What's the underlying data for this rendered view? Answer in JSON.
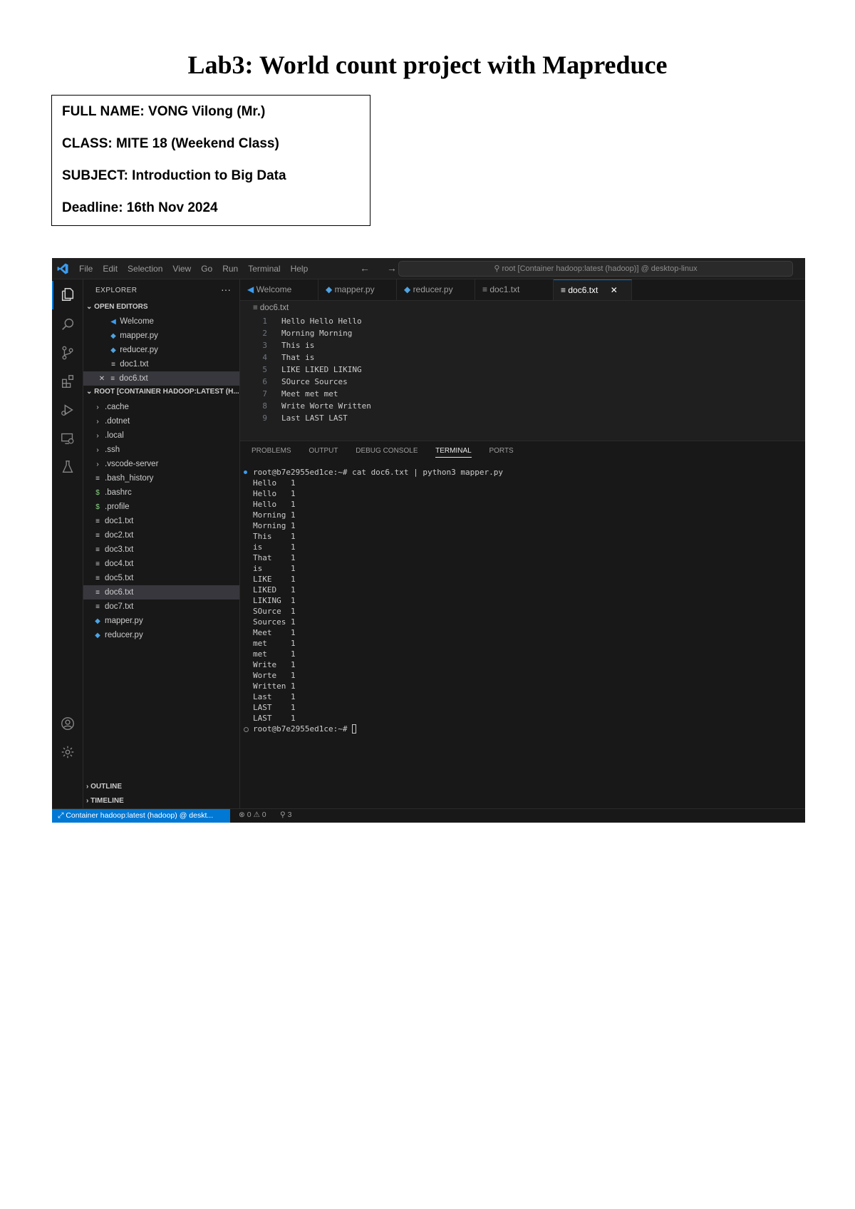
{
  "document": {
    "title": "Lab3: World count project with Mapreduce",
    "info": {
      "name": "FULL NAME: VONG Vilong (Mr.)",
      "class": "CLASS: MITE 18 (Weekend Class)",
      "subject": "SUBJECT: Introduction to Big Data",
      "deadline": "Deadline: 16th Nov 2024"
    }
  },
  "titlebar": {
    "menu": [
      "File",
      "Edit",
      "Selection",
      "View",
      "Go",
      "Run",
      "Terminal",
      "Help"
    ],
    "nav": "← →",
    "command_center": "root [Container hadoop:latest (hadoop)] @ desktop-linux"
  },
  "sidebar": {
    "header": "EXPLORER",
    "more": "···",
    "open_editors_label": "OPEN EDITORS",
    "open_editors": [
      {
        "name": "Welcome",
        "icon": "vscode-icon"
      },
      {
        "name": "mapper.py",
        "icon": "python-icon"
      },
      {
        "name": "reducer.py",
        "icon": "python-icon"
      },
      {
        "name": "doc1.txt",
        "icon": "text-file-icon"
      },
      {
        "name": "doc6.txt",
        "icon": "text-file-icon"
      }
    ],
    "root_label": "ROOT [CONTAINER HADOOP:LATEST (H...",
    "tree": [
      {
        "name": ".cache",
        "type": "folder"
      },
      {
        "name": ".dotnet",
        "type": "folder"
      },
      {
        "name": ".local",
        "type": "folder"
      },
      {
        "name": ".ssh",
        "type": "folder"
      },
      {
        "name": ".vscode-server",
        "type": "folder"
      },
      {
        "name": ".bash_history",
        "type": "txt"
      },
      {
        "name": ".bashrc",
        "type": "sh"
      },
      {
        "name": ".profile",
        "type": "sh"
      },
      {
        "name": "doc1.txt",
        "type": "txt"
      },
      {
        "name": "doc2.txt",
        "type": "txt"
      },
      {
        "name": "doc3.txt",
        "type": "txt"
      },
      {
        "name": "doc4.txt",
        "type": "txt"
      },
      {
        "name": "doc5.txt",
        "type": "txt"
      },
      {
        "name": "doc6.txt",
        "type": "txt"
      },
      {
        "name": "doc7.txt",
        "type": "txt"
      },
      {
        "name": "mapper.py",
        "type": "py"
      },
      {
        "name": "reducer.py",
        "type": "py"
      }
    ],
    "outline_label": "OUTLINE",
    "timeline_label": "TIMELINE"
  },
  "tabs": [
    {
      "label": "Welcome",
      "icon": "vscode-icon"
    },
    {
      "label": "mapper.py",
      "icon": "python-icon"
    },
    {
      "label": "reducer.py",
      "icon": "python-icon"
    },
    {
      "label": "doc1.txt",
      "icon": "text-file-icon"
    },
    {
      "label": "doc6.txt",
      "icon": "text-file-icon",
      "active": true
    }
  ],
  "editor": {
    "breadcrumb": "doc6.txt",
    "lines": [
      {
        "n": "1",
        "text": "Hello Hello Hello"
      },
      {
        "n": "2",
        "text": "Morning Morning"
      },
      {
        "n": "3",
        "text": "This is"
      },
      {
        "n": "4",
        "text": "That is"
      },
      {
        "n": "5",
        "text": "LIKE LIKED LIKING"
      },
      {
        "n": "6",
        "text": "SOurce Sources"
      },
      {
        "n": "7",
        "text": "Meet met met"
      },
      {
        "n": "8",
        "text": "Write Worte Written"
      },
      {
        "n": "9",
        "text": "Last LAST LAST"
      }
    ]
  },
  "panel": {
    "tabs": [
      "PROBLEMS",
      "OUTPUT",
      "DEBUG CONSOLE",
      "TERMINAL",
      "PORTS"
    ],
    "active_tab": "TERMINAL",
    "terminal": [
      "root@b7e2955ed1ce:~# cat doc6.txt | python3 mapper.py",
      "Hello   1",
      "Hello   1",
      "Hello   1",
      "Morning 1",
      "Morning 1",
      "This    1",
      "is      1",
      "That    1",
      "is      1",
      "LIKE    1",
      "LIKED   1",
      "LIKING  1",
      "SOurce  1",
      "Sources 1",
      "Meet    1",
      "met     1",
      "met     1",
      "Write   1",
      "Worte   1",
      "Written 1",
      "Last    1",
      "LAST    1",
      "LAST    1",
      "root@b7e2955ed1ce:~# "
    ]
  },
  "statusbar": {
    "remote": "Container hadoop:latest (hadoop) @ deskt...",
    "problems": "⊗ 0 ⚠ 0",
    "ports": "⚲ 3"
  },
  "colors": {
    "accent": "#0078d4",
    "editor_bg": "#1f1f1f",
    "panel_bg": "#181818",
    "python_icon": "#4fa3e0"
  }
}
